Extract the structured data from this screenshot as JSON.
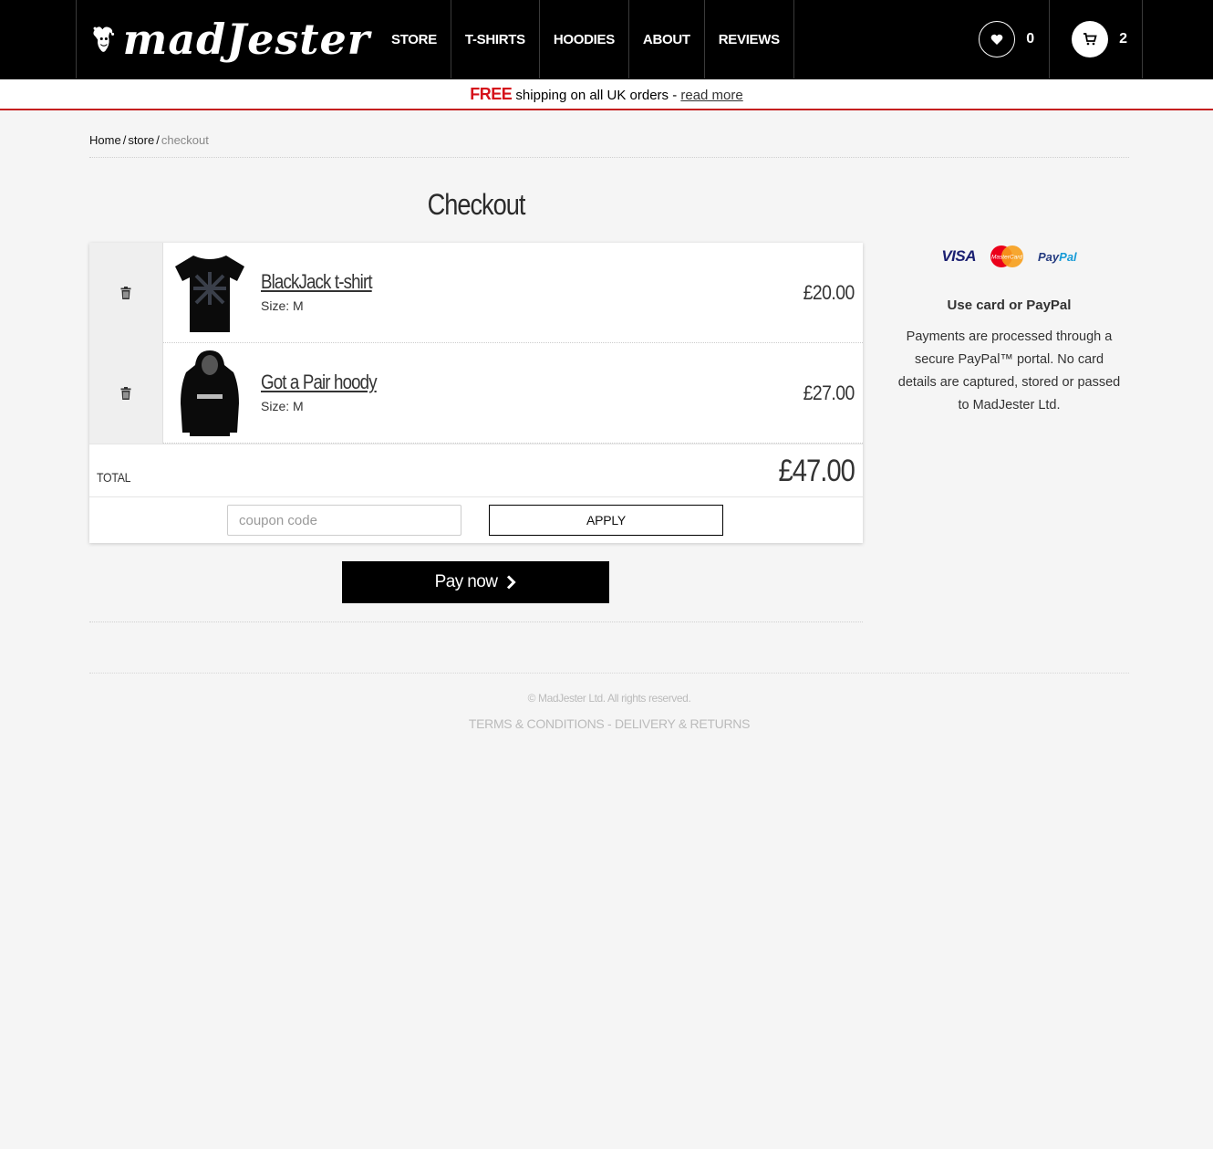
{
  "header": {
    "logo_text": "madJester",
    "nav": [
      "STORE",
      "T-SHIRTS",
      "HOODIES",
      "ABOUT",
      "REVIEWS"
    ],
    "wishlist_count": "0",
    "cart_count": "2"
  },
  "promo": {
    "free": "FREE",
    "text": " shipping on all UK orders - ",
    "link": "read more"
  },
  "breadcrumb": {
    "home": "Home",
    "store": "store",
    "current": "checkout",
    "sep": "/"
  },
  "page_title": "Checkout",
  "cart": {
    "items": [
      {
        "name": "BlackJack t-shirt",
        "size": "Size: M",
        "price": "£20.00"
      },
      {
        "name": "Got a Pair hoody",
        "size": "Size: M",
        "price": "£27.00"
      }
    ],
    "total_label": "TOTAL",
    "total_value": "£47.00",
    "coupon_placeholder": "coupon code",
    "apply_label": "APPLY",
    "pay_label": "Pay now"
  },
  "side": {
    "visa": "VISA",
    "mastercard": "MasterCard",
    "paypal_1": "Pay",
    "paypal_2": "Pal",
    "title": "Use card or PayPal",
    "text": "Payments are processed through a secure PayPal™ portal. No card details are captured, stored or passed to MadJester Ltd."
  },
  "footer": {
    "copyright": "© MadJester Ltd. All rights reserved.",
    "terms": "TERMS & CONDITIONS",
    "sep": " - ",
    "delivery": "DELIVERY & RETURNS"
  }
}
